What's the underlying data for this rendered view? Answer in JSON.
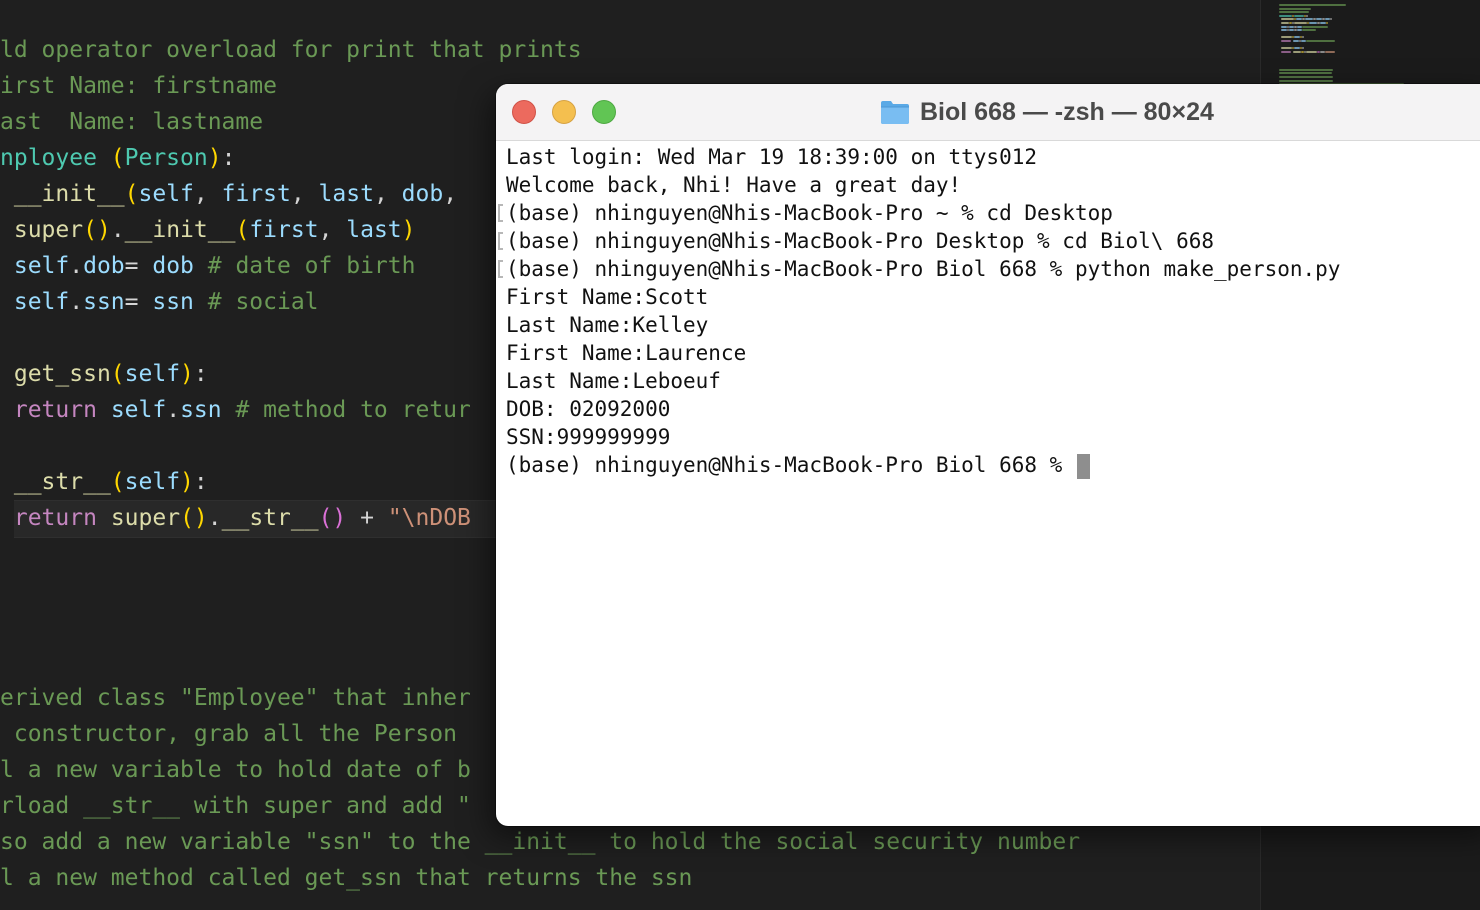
{
  "editor": {
    "lines": [
      {
        "segments": [
          {
            "t": "ld operator overload for print that prints",
            "c": "c"
          }
        ]
      },
      {
        "segments": [
          {
            "t": "irst Name: firstname",
            "c": "c"
          }
        ]
      },
      {
        "segments": [
          {
            "t": "ast  Name: lastname",
            "c": "c"
          }
        ]
      },
      {
        "segments": [
          {
            "t": "nployee ",
            "c": "cls"
          },
          {
            "t": "(",
            "c": "br1"
          },
          {
            "t": "Person",
            "c": "cls"
          },
          {
            "t": ")",
            "c": "br1"
          },
          {
            "t": ":",
            "c": "op"
          }
        ]
      },
      {
        "segments": [
          {
            "t": " ",
            "c": "op"
          },
          {
            "t": "__init__",
            "c": "fn"
          },
          {
            "t": "(",
            "c": "br1"
          },
          {
            "t": "self",
            "c": "self"
          },
          {
            "t": ", ",
            "c": "op"
          },
          {
            "t": "first",
            "c": "var"
          },
          {
            "t": ", ",
            "c": "op"
          },
          {
            "t": "last",
            "c": "var"
          },
          {
            "t": ", ",
            "c": "op"
          },
          {
            "t": "dob",
            "c": "var"
          },
          {
            "t": ",",
            "c": "op"
          }
        ]
      },
      {
        "segments": [
          {
            "t": " ",
            "c": "op"
          },
          {
            "t": "super",
            "c": "fn"
          },
          {
            "t": "()",
            "c": "br1"
          },
          {
            "t": ".",
            "c": "op"
          },
          {
            "t": "__init__",
            "c": "fn"
          },
          {
            "t": "(",
            "c": "br1"
          },
          {
            "t": "first",
            "c": "var"
          },
          {
            "t": ", ",
            "c": "op"
          },
          {
            "t": "last",
            "c": "var"
          },
          {
            "t": ")",
            "c": "br1"
          }
        ]
      },
      {
        "segments": [
          {
            "t": " ",
            "c": "op"
          },
          {
            "t": "self",
            "c": "self"
          },
          {
            "t": ".",
            "c": "op"
          },
          {
            "t": "dob",
            "c": "var"
          },
          {
            "t": "= ",
            "c": "op"
          },
          {
            "t": "dob",
            "c": "var"
          },
          {
            "t": " # date of birth",
            "c": "c"
          }
        ]
      },
      {
        "segments": [
          {
            "t": " ",
            "c": "op"
          },
          {
            "t": "self",
            "c": "self"
          },
          {
            "t": ".",
            "c": "op"
          },
          {
            "t": "ssn",
            "c": "var"
          },
          {
            "t": "= ",
            "c": "op"
          },
          {
            "t": "ssn",
            "c": "var"
          },
          {
            "t": " # social",
            "c": "c"
          }
        ]
      },
      {
        "segments": []
      },
      {
        "segments": [
          {
            "t": " ",
            "c": "op"
          },
          {
            "t": "get_ssn",
            "c": "fn"
          },
          {
            "t": "(",
            "c": "br1"
          },
          {
            "t": "self",
            "c": "self"
          },
          {
            "t": ")",
            "c": "br1"
          },
          {
            "t": ":",
            "c": "op"
          }
        ]
      },
      {
        "segments": [
          {
            "t": " ",
            "c": "op"
          },
          {
            "t": "return",
            "c": "kw"
          },
          {
            "t": " ",
            "c": "op"
          },
          {
            "t": "self",
            "c": "self"
          },
          {
            "t": ".",
            "c": "op"
          },
          {
            "t": "ssn",
            "c": "var"
          },
          {
            "t": " # method to retur",
            "c": "c"
          }
        ]
      },
      {
        "segments": []
      },
      {
        "segments": [
          {
            "t": " ",
            "c": "op"
          },
          {
            "t": "__str__",
            "c": "fn"
          },
          {
            "t": "(",
            "c": "br1"
          },
          {
            "t": "self",
            "c": "self"
          },
          {
            "t": ")",
            "c": "br1"
          },
          {
            "t": ":",
            "c": "op"
          }
        ]
      },
      {
        "segments": [
          {
            "t": " ",
            "c": "op"
          },
          {
            "t": "return",
            "c": "kw"
          },
          {
            "t": " ",
            "c": "op"
          },
          {
            "t": "super",
            "c": "fn"
          },
          {
            "t": "()",
            "c": "br1"
          },
          {
            "t": ".",
            "c": "op"
          },
          {
            "t": "__str__",
            "c": "fn"
          },
          {
            "t": "()",
            "c": "br2"
          },
          {
            "t": " + ",
            "c": "op"
          },
          {
            "t": "\"\\nDOB",
            "c": "str"
          }
        ]
      },
      {
        "segments": []
      },
      {
        "segments": []
      },
      {
        "segments": []
      },
      {
        "segments": []
      },
      {
        "segments": [
          {
            "t": "erived class \"Employee\" that inher",
            "c": "c"
          }
        ]
      },
      {
        "segments": [
          {
            "t": " constructor, grab all the Person",
            "c": "c"
          }
        ]
      },
      {
        "segments": [
          {
            "t": "l a new variable to hold date of b",
            "c": "c"
          }
        ]
      },
      {
        "segments": [
          {
            "t": "rload __str__ with super and add \"",
            "c": "c"
          }
        ]
      },
      {
        "segments": [
          {
            "t": "so add a new variable \"ssn\" to the __init__ to hold the social security number",
            "c": "c"
          }
        ]
      },
      {
        "segments": [
          {
            "t": "l a new method called get_ssn that returns the ssn",
            "c": "c"
          }
        ]
      }
    ]
  },
  "terminal": {
    "title": "Biol 668 — -zsh — 80×24",
    "lines": [
      {
        "text": "Last login: Wed Mar 19 18:39:00 on ttys012",
        "mark": false
      },
      {
        "text": "Welcome back, Nhi! Have a great day!",
        "mark": false
      },
      {
        "text": "(base) nhinguyen@Nhis-MacBook-Pro ~ % cd Desktop",
        "mark": true
      },
      {
        "text": "(base) nhinguyen@Nhis-MacBook-Pro Desktop % cd Biol\\ 668",
        "mark": true
      },
      {
        "text": "(base) nhinguyen@Nhis-MacBook-Pro Biol 668 % python make_person.py",
        "mark": true
      },
      {
        "text": "First Name:Scott",
        "mark": false
      },
      {
        "text": "Last Name:Kelley",
        "mark": false
      },
      {
        "text": "First Name:Laurence",
        "mark": false
      },
      {
        "text": "Last Name:Leboeuf",
        "mark": false
      },
      {
        "text": "DOB: 02092000",
        "mark": false
      },
      {
        "text": "SSN:999999999",
        "mark": false
      },
      {
        "text": "(base) nhinguyen@Nhis-MacBook-Pro Biol 668 % ",
        "mark": false,
        "cursor": true
      }
    ]
  },
  "colors": {
    "editor_bg": "#1f1f1f",
    "comment": "#6a9955",
    "keyword": "#c586c0",
    "function": "#dcdcaa",
    "class": "#4ec9b0",
    "variable": "#9cdcfe",
    "close_button": "#ec6a5e",
    "minimize_button": "#f4bf4f",
    "maximize_button": "#61c554"
  },
  "icons": {
    "title_icon": "folder-icon",
    "close": "close-button",
    "minimize": "minimize-button",
    "maximize": "maximize-button"
  }
}
